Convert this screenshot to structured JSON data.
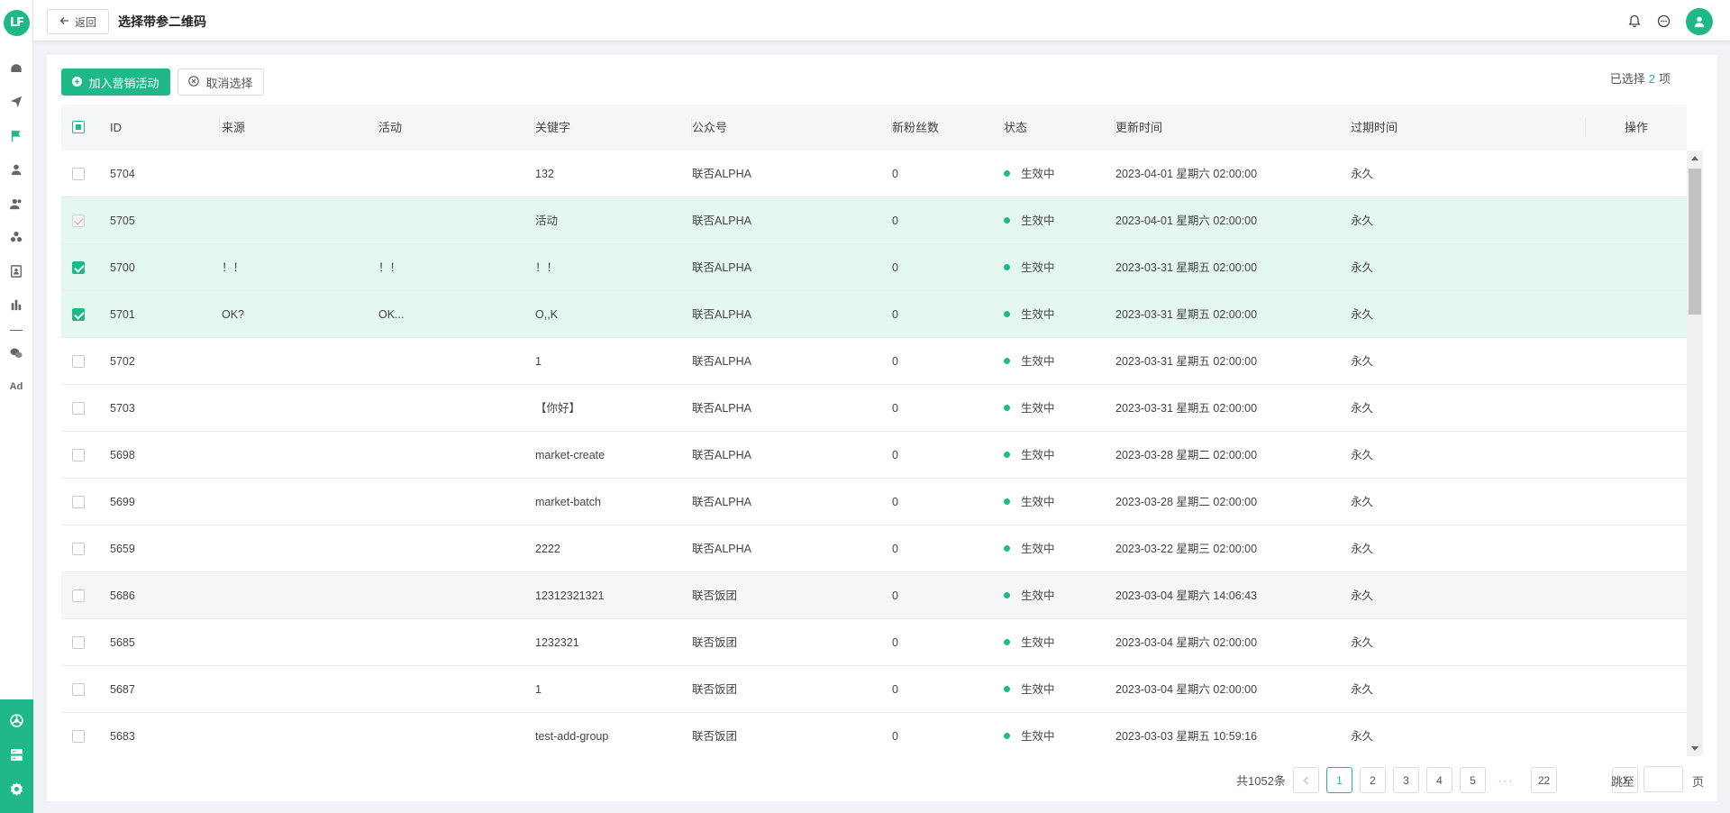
{
  "app": {
    "logo_text": "LF"
  },
  "header": {
    "back_label": "返回",
    "title": "选择带参二维码"
  },
  "toolbar": {
    "add_label": "加入营销活动",
    "cancel_label": "取消选择",
    "selected_prefix": "已选择",
    "selected_count": "2",
    "selected_suffix": "项"
  },
  "table": {
    "columns": [
      "ID",
      "来源",
      "活动",
      "关键字",
      "公众号",
      "新粉丝数",
      "状态",
      "更新时间",
      "过期时间",
      "操作"
    ],
    "rows": [
      {
        "check": "off",
        "id": "5704",
        "source": "",
        "activity": "",
        "keyword": "132",
        "account": "联否ALPHA",
        "fans": "0",
        "status": "生效中",
        "updated": "2023-04-01 星期六 02:00:00",
        "expire": "永久"
      },
      {
        "check": "disabled",
        "id": "5705",
        "source": "",
        "activity": "",
        "keyword": "活动",
        "account": "联否ALPHA",
        "fans": "0",
        "status": "生效中",
        "updated": "2023-04-01 星期六 02:00:00",
        "expire": "永久"
      },
      {
        "check": "on",
        "id": "5700",
        "source": "！！",
        "activity": "！！",
        "keyword": "！！",
        "account": "联否ALPHA",
        "fans": "0",
        "status": "生效中",
        "updated": "2023-03-31 星期五 02:00:00",
        "expire": "永久"
      },
      {
        "check": "on",
        "id": "5701",
        "source": "OK?",
        "activity": "OK...",
        "keyword": "O,,K",
        "account": "联否ALPHA",
        "fans": "0",
        "status": "生效中",
        "updated": "2023-03-31 星期五 02:00:00",
        "expire": "永久"
      },
      {
        "check": "off",
        "id": "5702",
        "source": "",
        "activity": "",
        "keyword": "1",
        "account": "联否ALPHA",
        "fans": "0",
        "status": "生效中",
        "updated": "2023-03-31 星期五 02:00:00",
        "expire": "永久"
      },
      {
        "check": "off",
        "id": "5703",
        "source": "",
        "activity": "",
        "keyword": "【你好】",
        "account": "联否ALPHA",
        "fans": "0",
        "status": "生效中",
        "updated": "2023-03-31 星期五 02:00:00",
        "expire": "永久"
      },
      {
        "check": "off",
        "id": "5698",
        "source": "",
        "activity": "",
        "keyword": "market-create",
        "account": "联否ALPHA",
        "fans": "0",
        "status": "生效中",
        "updated": "2023-03-28 星期二 02:00:00",
        "expire": "永久"
      },
      {
        "check": "off",
        "id": "5699",
        "source": "",
        "activity": "",
        "keyword": "market-batch",
        "account": "联否ALPHA",
        "fans": "0",
        "status": "生效中",
        "updated": "2023-03-28 星期二 02:00:00",
        "expire": "永久"
      },
      {
        "check": "off",
        "id": "5659",
        "source": "",
        "activity": "",
        "keyword": "2222",
        "account": "联否ALPHA",
        "fans": "0",
        "status": "生效中",
        "updated": "2023-03-22 星期三 02:00:00",
        "expire": "永久"
      },
      {
        "check": "off",
        "id": "5686",
        "source": "",
        "activity": "",
        "keyword": "12312321321",
        "account": "联否饭团",
        "fans": "0",
        "status": "生效中",
        "updated": "2023-03-04 星期六 14:06:43",
        "expire": "永久"
      },
      {
        "check": "off",
        "id": "5685",
        "source": "",
        "activity": "",
        "keyword": "1232321",
        "account": "联否饭团",
        "fans": "0",
        "status": "生效中",
        "updated": "2023-03-04 星期六 02:00:00",
        "expire": "永久"
      },
      {
        "check": "off",
        "id": "5687",
        "source": "",
        "activity": "",
        "keyword": "1",
        "account": "联否饭团",
        "fans": "0",
        "status": "生效中",
        "updated": "2023-03-04 星期六 02:00:00",
        "expire": "永久"
      },
      {
        "check": "off",
        "id": "5683",
        "source": "",
        "activity": "",
        "keyword": "test-add-group",
        "account": "联否饭团",
        "fans": "0",
        "status": "生效中",
        "updated": "2023-03-03 星期五 10:59:16",
        "expire": "永久"
      }
    ]
  },
  "pagination": {
    "total_label": "共1052条",
    "pages": [
      "1",
      "2",
      "3",
      "4",
      "5",
      "···",
      "22"
    ],
    "current": "1",
    "jump_label": "跳至",
    "page_suffix": "页"
  },
  "colors": {
    "brand": "#1fb989",
    "selected_row": "#e4f8f0"
  }
}
